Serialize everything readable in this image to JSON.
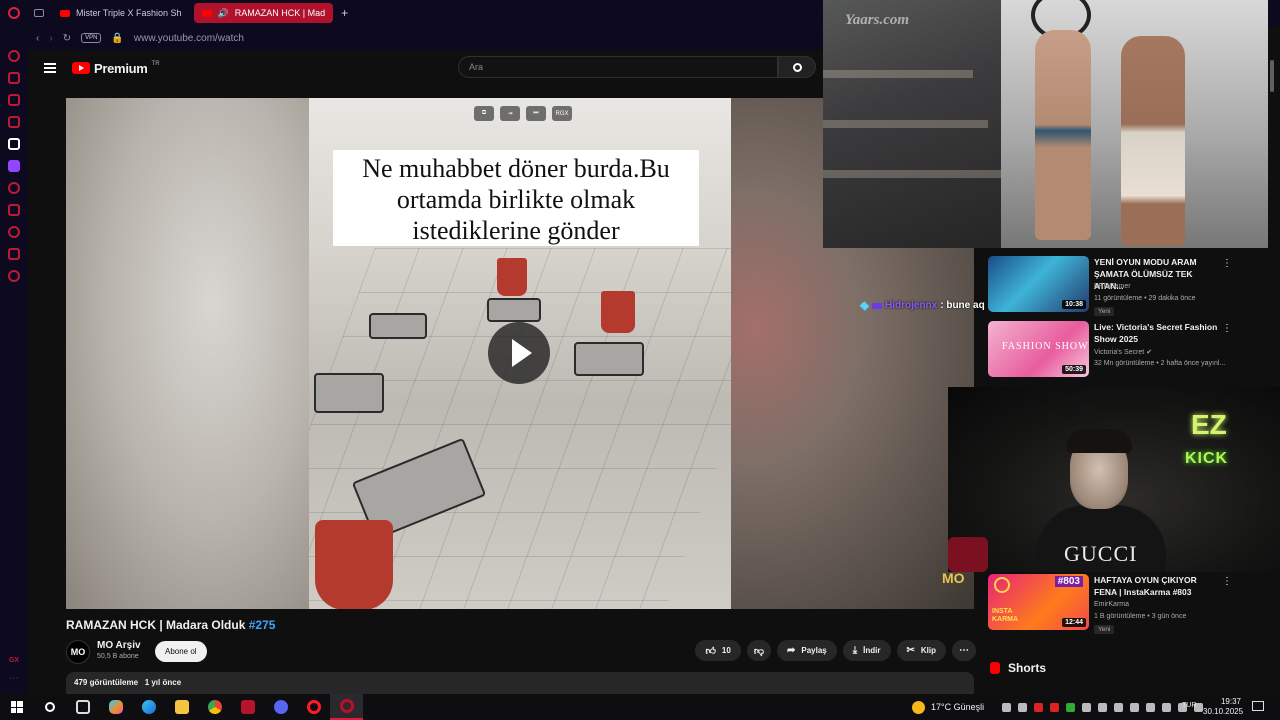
{
  "browser": {
    "tabs": [
      {
        "label": "Mister Triple X Fashion Sh",
        "active": false
      },
      {
        "label": "RAMAZAN HCK | Mad",
        "active": true
      }
    ],
    "new_tab": "+",
    "vpn_label": "VPN",
    "url": "www.youtube.com/watch"
  },
  "youtube": {
    "logo_text": "Premium",
    "logo_region": "TR",
    "search_placeholder": "Ara",
    "video": {
      "caption": "Ne muhabbet döner burda.Bu ortamda birlikte olmak istediklerine gönder",
      "overlay_badge": "RGX",
      "watermark": "MO",
      "title": "RAMAZAN HCK | Madara Olduk",
      "title_tag": "#275",
      "channel": "MO Arşiv",
      "channel_avatar": "MO",
      "subscribers": "50,5 B abone",
      "subscribe_label": "Abone ol",
      "likes": "10",
      "share_label": "Paylaş",
      "download_label": "İndir",
      "clip_label": "Klip",
      "views": "479 görüntüleme",
      "age": "1 yıl önce"
    },
    "recommendations": [
      {
        "title": "YENİ OYUN MODU ARAM ŞAMATA ÖLÜMSÜZ TEK ATAN...",
        "channel": "BROGamer",
        "meta": "11 görüntüleme • 29 dakika önce",
        "badge": "Yeni",
        "duration": "10:38"
      },
      {
        "title": "Live: Victoria's Secret Fashion Show 2025",
        "channel": "Victoria's Secret",
        "meta": "32 Mn görüntüleme • 2 hafta önce yayınl...",
        "badge": "",
        "duration": "50:39",
        "thumb_text": "FASHION SHOW"
      },
      {
        "title": "HAFTAYA OYUN ÇIKIYOR FENA | InstaKarma #803",
        "channel": "EmirKarma",
        "meta": "1 B görüntüleme • 3 gün önce",
        "badge": "Yeni",
        "duration": "12:44",
        "thumb_text": "#803",
        "thumb_sub": "INSTA KARMA"
      }
    ],
    "shorts_label": "Shorts"
  },
  "stream_overlay": {
    "runway_logo": "Yaars.com",
    "chat_user": "Hidrojennx",
    "chat_text": ": bune aq",
    "neon_ez": "EZ",
    "neon_kick": "KICK",
    "shirt_text": "GUCCI"
  },
  "taskbar": {
    "weather": "17°C  Güneşli",
    "language": "TUR",
    "time": "19:37",
    "date": "30.10.2025",
    "apps": [
      "start",
      "search",
      "task-view",
      "copilot",
      "edge",
      "explorer",
      "chrome",
      "voicemeeter",
      "discord",
      "opera",
      "opera-gx"
    ]
  },
  "colors": {
    "accent": "#e01a3c",
    "youtube_red": "#ff0000",
    "link_blue": "#3ea6ff",
    "neon_green": "#b7f15a"
  }
}
